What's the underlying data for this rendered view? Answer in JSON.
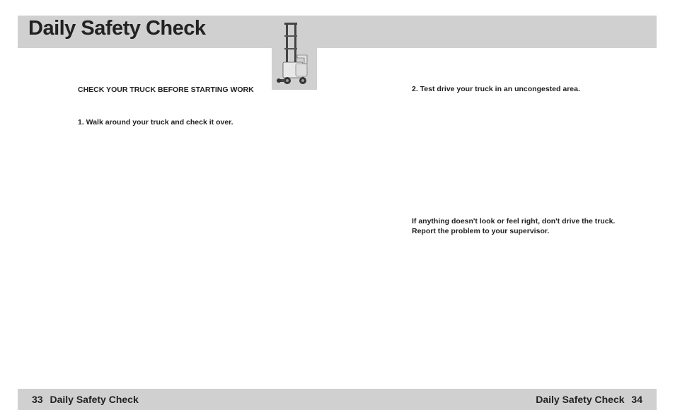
{
  "header": {
    "title": "Daily Safety Check"
  },
  "left_column": {
    "subheading": "CHECK YOUR TRUCK BEFORE STARTING WORK",
    "step1": "1.  Walk around your truck and check it over."
  },
  "right_column": {
    "step2": "2.  Test drive your truck in an uncongested area.",
    "warning": "If anything doesn't look or feel right, don't drive the truck. Report the problem to your supervisor."
  },
  "footer": {
    "left_num": "33",
    "left_label": "Daily Safety Check",
    "right_label": "Daily Safety Check",
    "right_num": "34"
  }
}
